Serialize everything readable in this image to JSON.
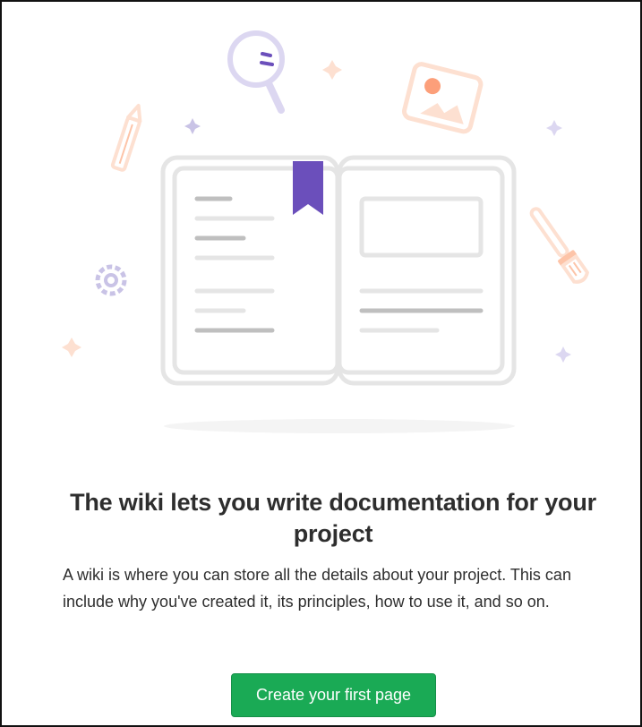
{
  "empty_state": {
    "title": "The wiki lets you write documentation for your project",
    "description": "A wiki is where you can store all the details about your project. This can include why you've created it, its principles, how to use it, and so on.",
    "create_button_label": "Create your first page"
  },
  "colors": {
    "primary_button": "#1aaa55",
    "bookmark": "#6b4fbb",
    "book_outline": "#e5e5e5",
    "accent_orange": "#fdc4a8",
    "accent_purple": "#c9c3e6"
  },
  "icons": [
    "search-icon",
    "image-icon",
    "pencil-icon",
    "gear-icon",
    "paintbrush-icon",
    "bookmark-icon",
    "sparkle-icon"
  ]
}
